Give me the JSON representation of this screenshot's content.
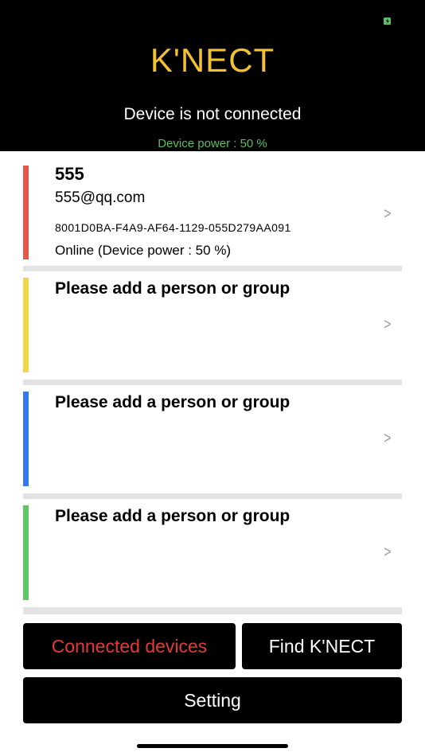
{
  "status_bar": {
    "battery_icon": "battery-charging-icon",
    "battery_color": "#5fbf63"
  },
  "header": {
    "title": "K'NECT",
    "title_color": "#f2c233",
    "connection_status": "Device is not connected",
    "device_power": "Device power : 50 %",
    "device_power_color": "#5fbf63"
  },
  "contacts": [
    {
      "color": "#e8544a",
      "name": "555",
      "email": "555@qq.com",
      "device_id": "8001D0BA-F4A9-AF64-1129-055D279AA091",
      "status": "Online (Device power : 50 %)",
      "chevron": ">"
    },
    {
      "color": "#f5d548",
      "placeholder": "Please add a person or group",
      "chevron": ">"
    },
    {
      "color": "#3478f6",
      "placeholder": "Please add a person or group",
      "chevron": ">"
    },
    {
      "color": "#5fc660",
      "placeholder": "Please add a person or group",
      "chevron": ">"
    }
  ],
  "buttons": {
    "connected_devices": "Connected devices",
    "connected_devices_color": "#e23a35",
    "find_knect": "Find K'NECT",
    "setting": "Setting"
  }
}
